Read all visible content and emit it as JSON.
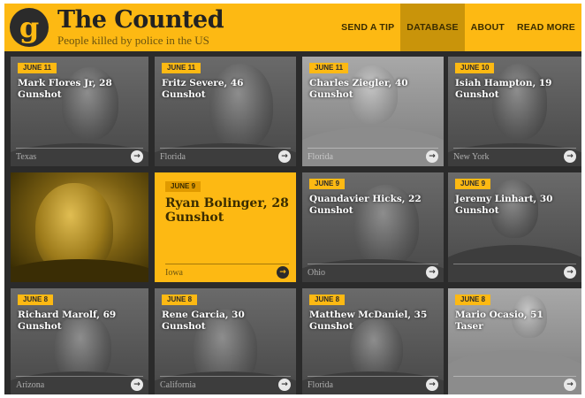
{
  "header": {
    "logo_glyph": "g",
    "title": "The Counted",
    "subtitle": "People killed by police in the US",
    "nav": [
      {
        "label": "SEND A TIP",
        "active": false
      },
      {
        "label": "DATABASE",
        "active": true
      },
      {
        "label": "ABOUT",
        "active": false
      },
      {
        "label": "READ MORE",
        "active": false
      }
    ]
  },
  "colors": {
    "accent": "#fdb913",
    "dark": "#2b2b2b"
  },
  "cards": [
    {
      "date": "JUNE 11",
      "name_age": "Mark Flores Jr, 28",
      "cause": "Gunshot",
      "state": "Texas"
    },
    {
      "date": "JUNE 11",
      "name_age": "Fritz Severe, 46",
      "cause": "Gunshot",
      "state": "Florida"
    },
    {
      "date": "JUNE 11",
      "name_age": "Charles Ziegler, 40",
      "cause": "Gunshot",
      "state": "Florida"
    },
    {
      "date": "JUNE 10",
      "name_age": "Isiah Hampton, 19",
      "cause": "Gunshot",
      "state": "New York"
    },
    {
      "date": "JUNE 9",
      "name_age": "Ryan Bolinger, 28",
      "cause": "Gunshot",
      "state": "Iowa"
    },
    {
      "date": "JUNE 9",
      "name_age": "Quandavier Hicks, 22",
      "cause": "Gunshot",
      "state": "Ohio"
    },
    {
      "date": "JUNE 9",
      "name_age": "Jeremy Linhart, 30",
      "cause": "Gunshot",
      "state": ""
    },
    {
      "date": "JUNE 8",
      "name_age": "Richard Marolf, 69",
      "cause": "Gunshot",
      "state": "Arizona"
    },
    {
      "date": "JUNE 8",
      "name_age": "Rene Garcia, 30",
      "cause": "Gunshot",
      "state": "California"
    },
    {
      "date": "JUNE 8",
      "name_age": "Matthew McDaniel, 35",
      "cause": "Gunshot",
      "state": "Florida"
    },
    {
      "date": "JUNE 8",
      "name_age": "Mario Ocasio, 51",
      "cause": "Taser",
      "state": ""
    }
  ],
  "arrow_icon": "→"
}
